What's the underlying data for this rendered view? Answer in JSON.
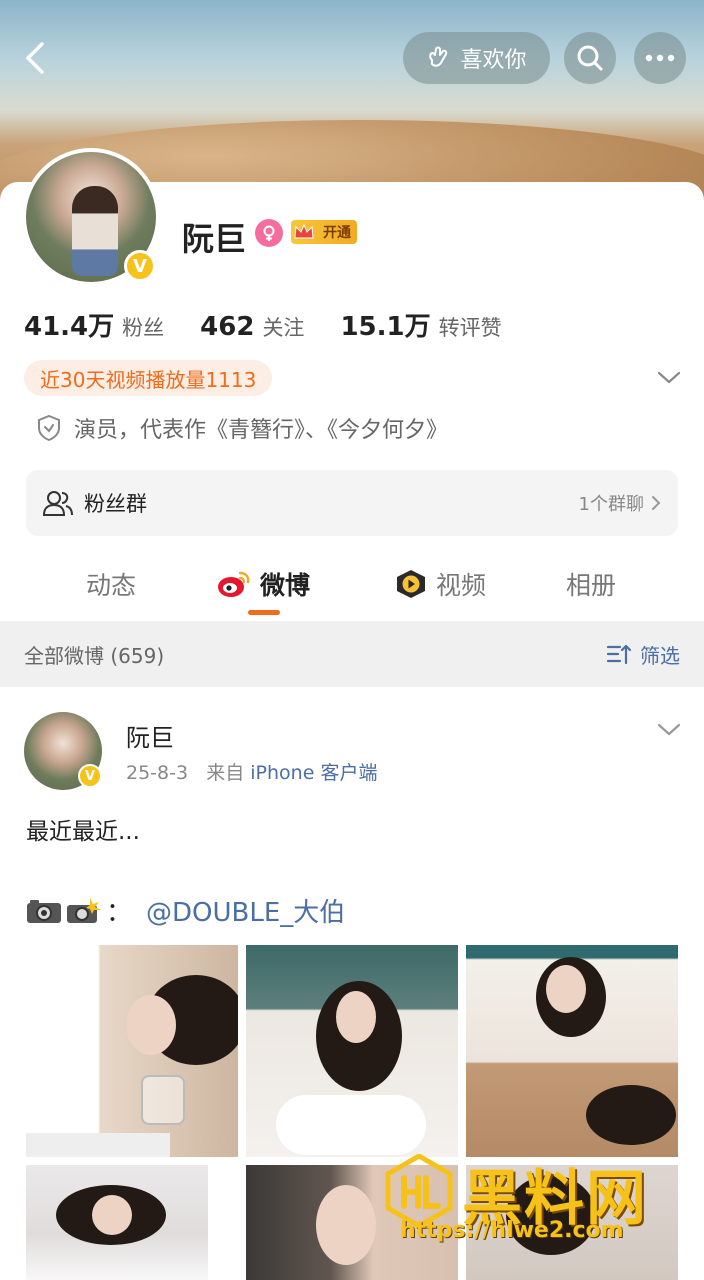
{
  "header": {
    "like_label": "喜欢你"
  },
  "profile": {
    "name": "阮巨",
    "vip_label": "开通",
    "verified_mark": "V",
    "stats": [
      {
        "value": "41.4万",
        "label": "粉丝"
      },
      {
        "value": "462",
        "label": "关注"
      },
      {
        "value": "15.1万",
        "label": "转评赞"
      }
    ],
    "play_count_text": "近30天视频播放量1113",
    "description": "演员，代表作《青簪行》、《今夕何夕》"
  },
  "fan_group": {
    "title": "粉丝群",
    "count_text": "1个群聊"
  },
  "tabs": [
    {
      "label": "动态",
      "active": false
    },
    {
      "label": "微博",
      "active": true
    },
    {
      "label": "视频",
      "active": false
    },
    {
      "label": "相册",
      "active": false
    }
  ],
  "filter": {
    "count_text": "全部微博 (659)",
    "filter_label": "筛选"
  },
  "post": {
    "author": "阮巨",
    "date": "25-8-3",
    "source_prefix": "来自",
    "source": "iPhone 客户端",
    "text": "最近最近...",
    "credit_sep": "：",
    "mention": "@DOUBLE_大伯"
  },
  "watermark": {
    "title": "黑料网",
    "url": "https://hlwe2.com"
  },
  "colors": {
    "accent": "#f06b1a",
    "link": "#4a6ea5",
    "verified": "#f7c21a"
  }
}
